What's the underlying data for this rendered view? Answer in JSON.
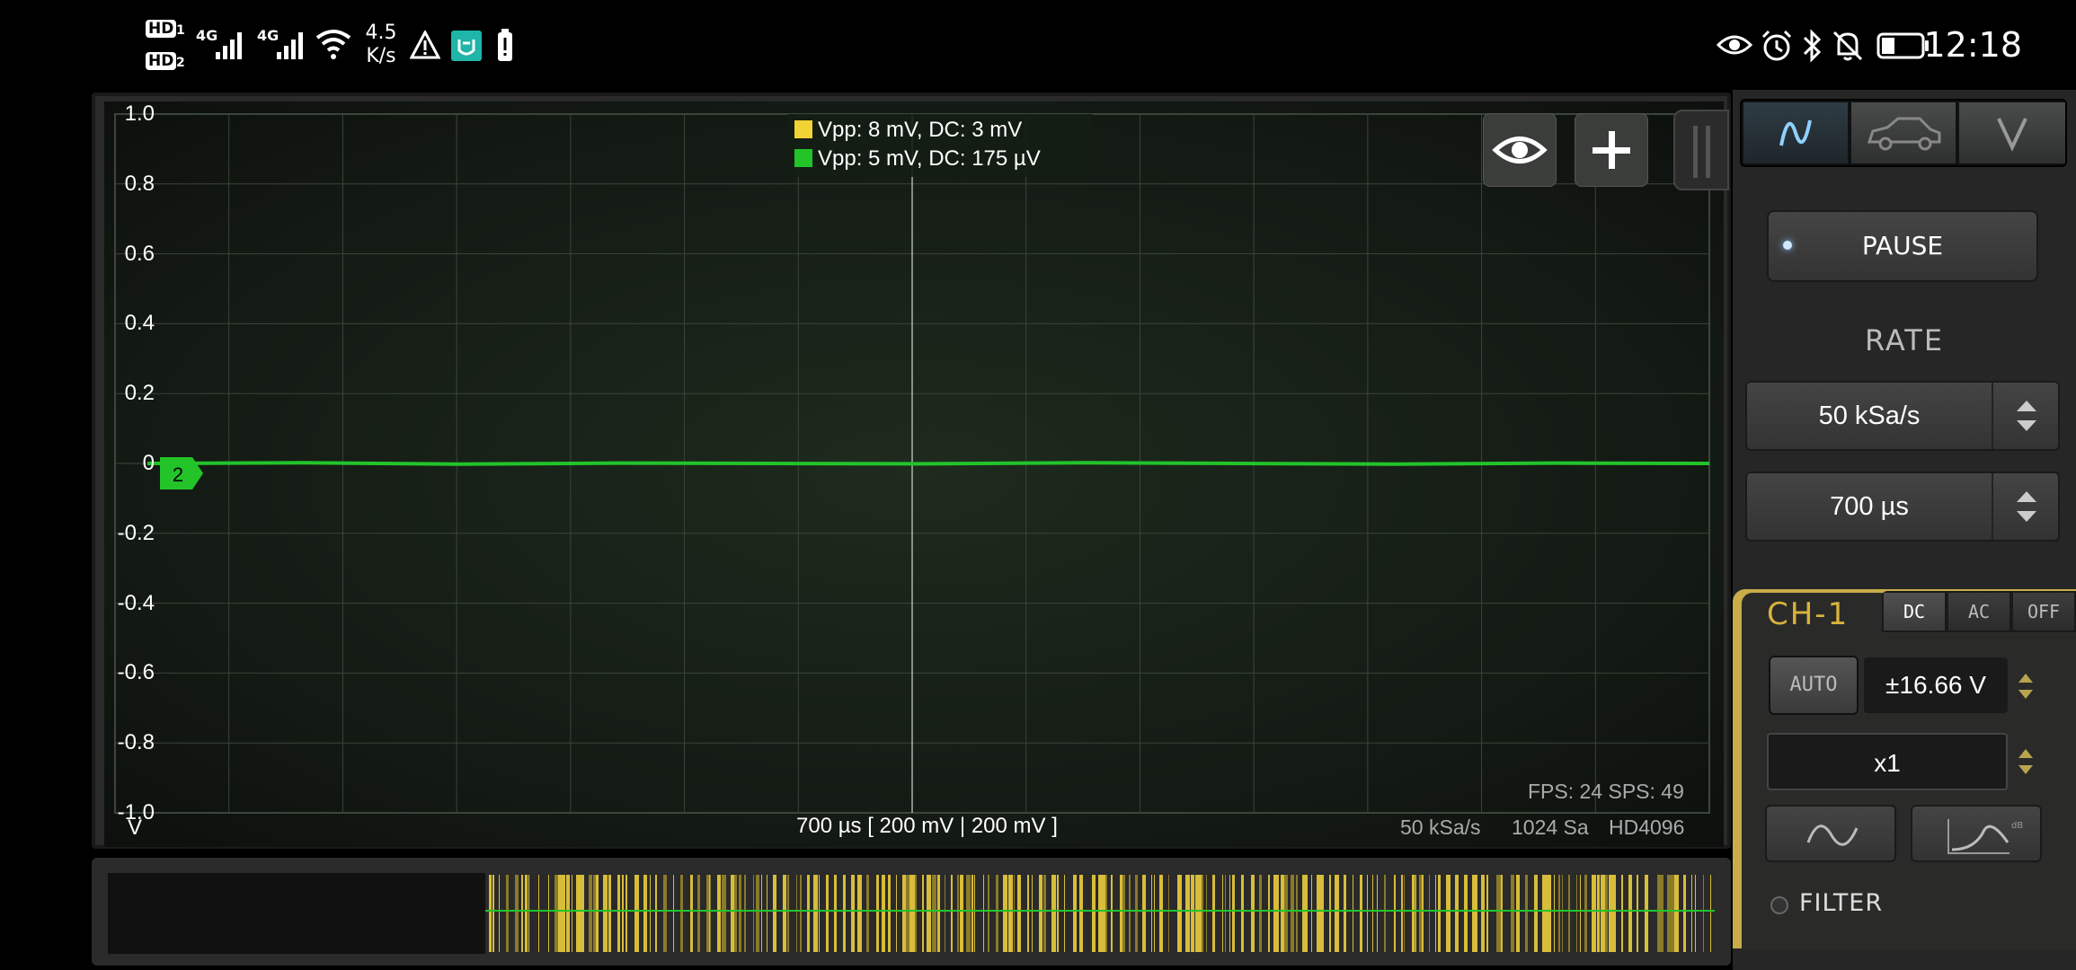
{
  "status_bar": {
    "sim1": "HD",
    "sim1_index": "1",
    "sim2": "HD",
    "sim2_index": "2",
    "network1": "4G",
    "network2": "4G",
    "net_speed_value": "4.5",
    "net_speed_unit": "K/s",
    "time": "12:18"
  },
  "legend": {
    "ch1": "Vpp: 8 mV, DC: 3 mV",
    "ch2": "Vpp: 5 mV, DC: 175 µV",
    "ch1_color": "#f2d335",
    "ch2_color": "#22c42a"
  },
  "chart_data": {
    "type": "line",
    "y_tick_labels": [
      "1.0",
      "0.8",
      "0.6",
      "0.4",
      "0.2",
      "0",
      "-0.2",
      "-0.4",
      "-0.6",
      "-0.8",
      "-1.0"
    ],
    "ylim": [
      -1.0,
      1.0
    ],
    "ylabel": "V",
    "grid": true,
    "series": [
      {
        "values": [
          0,
          0.002,
          -0.002,
          0.001,
          0,
          -0.001,
          0.002,
          0,
          -0.002,
          0.001,
          0
        ]
      }
    ]
  },
  "plot": {
    "marker_label": "2",
    "unit_label": "V",
    "timebase_label": "700 µs  [ 200 mV | 200 mV ]",
    "fps": "FPS: 24  SPS: 49",
    "samplerate_info": "50 kSa/s",
    "samples_info": "1024 Sa",
    "device_info": "HD4096"
  },
  "toolbar": {
    "visibility_icon": "eye-icon",
    "add_icon": "plus-icon"
  },
  "panel": {
    "pause_label": "PAUSE",
    "rate_title": "RATE",
    "rate_value": "50 kSa/s",
    "time_value": "700 µs"
  },
  "channel": {
    "title": "CH-1",
    "dc_label": "DC",
    "ac_label": "AC",
    "off_label": "OFF",
    "auto_label": "AUTO",
    "range_value": "±16.66 V",
    "probe_value": "x1",
    "filter_label": "FILTER",
    "accent_color": "#c9ad4a"
  }
}
